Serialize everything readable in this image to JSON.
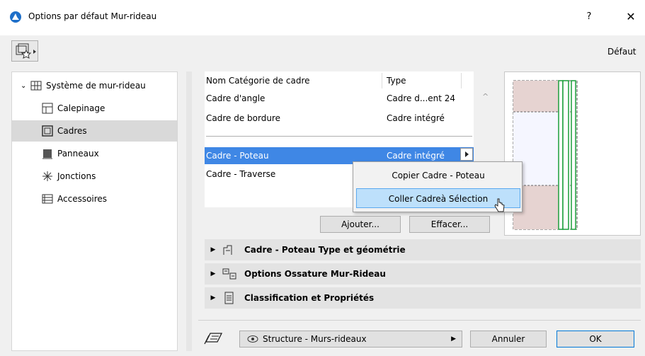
{
  "window": {
    "title": "Options par défaut Mur-rideau",
    "help_label": "?",
    "close_label": "✕"
  },
  "toolbar": {
    "default_label": "Défaut"
  },
  "tree": {
    "root_label": "Système de mur-rideau",
    "items": [
      {
        "label": "Calepinage",
        "icon": "grid-layout-icon"
      },
      {
        "label": "Cadres",
        "icon": "frame-icon"
      },
      {
        "label": "Panneaux",
        "icon": "panel-icon"
      },
      {
        "label": "Jonctions",
        "icon": "junction-icon"
      },
      {
        "label": "Accessoires",
        "icon": "accessories-icon"
      }
    ],
    "selected": "Cadres"
  },
  "frames_table": {
    "columns": [
      "Nom Catégorie de cadre",
      "Type"
    ],
    "rows": [
      {
        "name": "Cadre d'angle",
        "type": "Cadre d...ent 24"
      },
      {
        "name": "Cadre de bordure",
        "type": "Cadre intégré"
      },
      {
        "name": "Cadre - Poteau",
        "type": "Cadre intégré"
      },
      {
        "name": "Cadre - Traverse",
        "type": ""
      }
    ],
    "selected_row": "Cadre - Poteau"
  },
  "context_menu": {
    "items": [
      {
        "label": "Copier Cadre - Poteau"
      },
      {
        "label": "Coller Cadreà Sélection"
      }
    ],
    "hovered": "Coller Cadreà Sélection"
  },
  "buttons": {
    "add_label": "Ajouter...",
    "delete_label": "Effacer...",
    "cancel_label": "Annuler",
    "ok_label": "OK"
  },
  "sections": [
    {
      "label": "Cadre - Poteau Type et géométrie",
      "icon": "frame-geometry-icon"
    },
    {
      "label": "Options Ossature Mur-Rideau",
      "icon": "framing-options-icon"
    },
    {
      "label": "Classification et Propriétés",
      "icon": "properties-icon"
    }
  ],
  "footer": {
    "layer_label": "Structure - Murs-rideaux"
  },
  "colors": {
    "selection": "#3f87e5",
    "menu_hover": "#bde0fb",
    "frame_green": "#1a9e3a",
    "panel_pink": "#e6d3d1"
  }
}
